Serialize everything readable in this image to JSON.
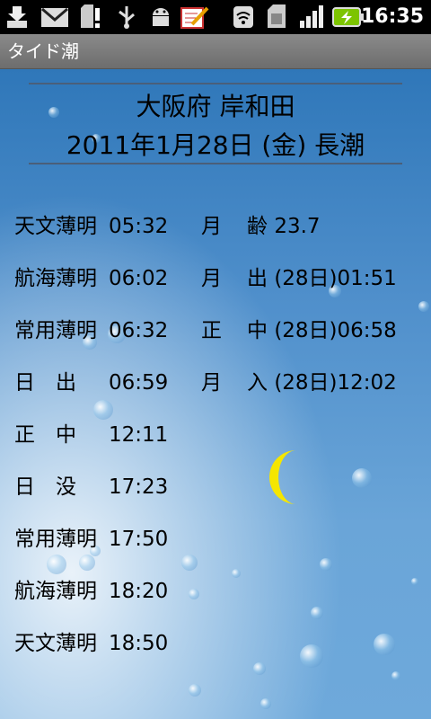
{
  "status_bar": {
    "icons": [
      "download-icon",
      "gmail-icon",
      "sd-card-alert-icon",
      "usb-icon",
      "android-debug-icon",
      "edit-icon",
      "wifi-icon",
      "sim-icon",
      "signal-icon",
      "battery-charging-icon"
    ],
    "time": "16:35"
  },
  "app_title": "タイド潮",
  "header": {
    "location": "大阪府 岸和田",
    "date_line": "2011年1月28日 (金) 長潮"
  },
  "sun_times": [
    {
      "label": "天文薄明",
      "time": "05:32"
    },
    {
      "label": "航海薄明",
      "time": "06:02"
    },
    {
      "label": "常用薄明",
      "time": "06:32"
    },
    {
      "label": "日　出",
      "time": "06:59"
    },
    {
      "label": "正　中",
      "time": "12:11"
    },
    {
      "label": "日　没",
      "time": "17:23"
    },
    {
      "label": "常用薄明",
      "time": "17:50"
    },
    {
      "label": "航海薄明",
      "time": "18:20"
    },
    {
      "label": "天文薄明",
      "time": "18:50"
    }
  ],
  "moon_info": [
    {
      "label": "月",
      "label2": "齢",
      "value": "23.7"
    },
    {
      "label": "月",
      "label2": "出",
      "value": "(28日)01:51"
    },
    {
      "label": "正",
      "label2": "中",
      "value": "(28日)06:58"
    },
    {
      "label": "月",
      "label2": "入",
      "value": "(28日)12:02"
    }
  ],
  "moon_color": "#f5e600"
}
